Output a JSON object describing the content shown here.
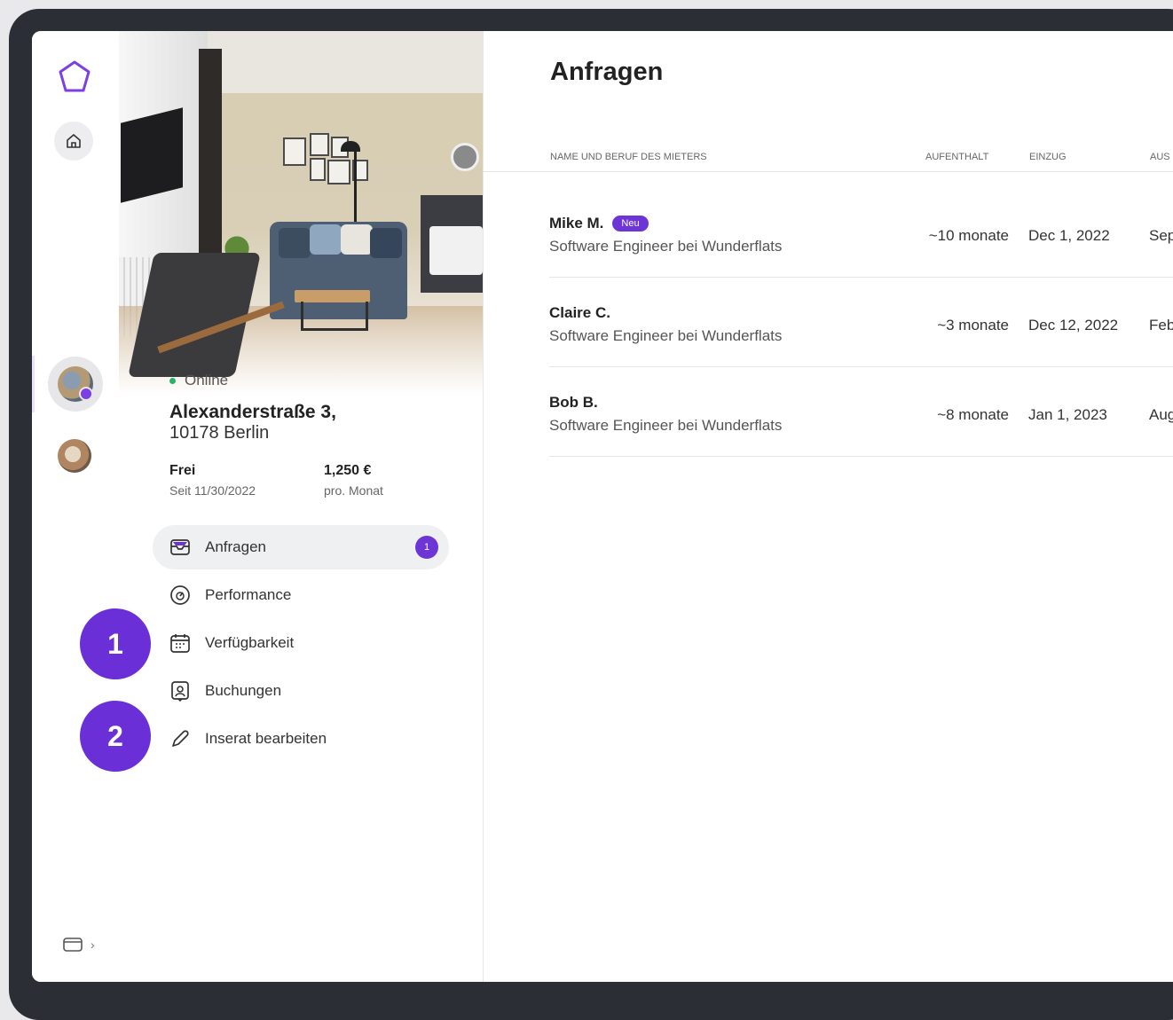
{
  "colors": {
    "accent": "#6d35d6",
    "online": "#27b46a"
  },
  "property": {
    "status": "Online",
    "address_line1": "Alexanderstraße 3,",
    "address_line2": "10178 Berlin",
    "availability_label": "Frei",
    "availability_sub": "Seit 11/30/2022",
    "price": "1,250 €",
    "price_sub": "pro. Monat"
  },
  "menu": {
    "items": [
      {
        "label": "Anfragen",
        "icon": "inbox-icon",
        "count": "1"
      },
      {
        "label": "Performance",
        "icon": "gauge-icon"
      },
      {
        "label": "Verfügbarkeit",
        "icon": "calendar-icon"
      },
      {
        "label": "Buchungen",
        "icon": "contact-card-icon"
      },
      {
        "label": "Inserat bearbeiten",
        "icon": "pencil-icon"
      }
    ]
  },
  "markers": [
    "1",
    "2"
  ],
  "main": {
    "title": "Anfragen",
    "columns": [
      "NAME UND BERUF DES MIETERS",
      "AUFENTHALT",
      "EINZUG",
      "AUS"
    ],
    "rows": [
      {
        "name": "Mike M.",
        "badge": "Neu",
        "job": "Software Engineer bei Wunderflats",
        "stay": "~10 monate",
        "move_in": "Dec 1, 2022",
        "move_out": "Sep"
      },
      {
        "name": "Claire C.",
        "job": "Software Engineer bei Wunderflats",
        "stay": "~3 monate",
        "move_in": "Dec 12, 2022",
        "move_out": "Feb"
      },
      {
        "name": "Bob B.",
        "job": "Software Engineer bei Wunderflats",
        "stay": "~8 monate",
        "move_in": "Jan 1, 2023",
        "move_out": "Aug"
      }
    ]
  },
  "rail": {
    "bottom_chevron": "›"
  }
}
